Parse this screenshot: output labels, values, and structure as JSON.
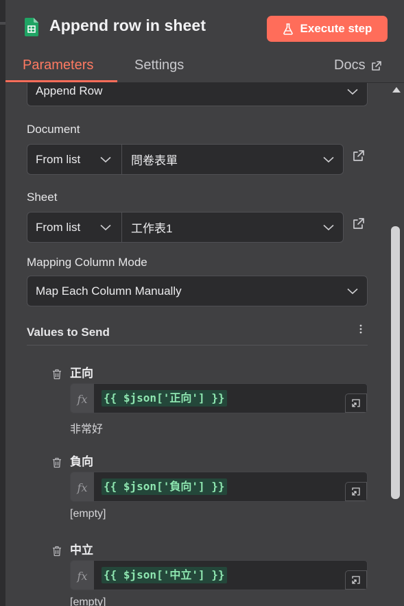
{
  "header": {
    "title": "Append row in sheet",
    "execute_label": "Execute step",
    "tabs": {
      "parameters": "Parameters",
      "settings": "Settings",
      "docs": "Docs"
    }
  },
  "operation": {
    "value": "Append Row"
  },
  "document": {
    "label": "Document",
    "mode": "From list",
    "value": "問卷表單"
  },
  "sheet": {
    "label": "Sheet",
    "mode": "From list",
    "value": "工作表1"
  },
  "mapping": {
    "label": "Mapping Column Mode",
    "value": "Map Each Column Manually"
  },
  "values_section": {
    "label": "Values to Send",
    "fields": [
      {
        "name": "正向",
        "expression": "{{ $json['正向'] }}",
        "result": "非常好"
      },
      {
        "name": "負向",
        "expression": "{{ $json['負向'] }}",
        "result": "[empty]"
      },
      {
        "name": "中立",
        "expression": "{{ $json['中立'] }}",
        "result": "[empty]"
      }
    ]
  },
  "colors": {
    "accent": "#ff6d5a",
    "panel": "#404042",
    "input": "#2b2b2d",
    "code_bg": "#24473a",
    "code_fg": "#8ee6b0"
  },
  "icons": [
    "sheets-icon",
    "flask-icon",
    "external-link-icon",
    "chevron-down-icon",
    "trash-icon",
    "fx-icon",
    "expand-icon",
    "kebab-icon"
  ]
}
